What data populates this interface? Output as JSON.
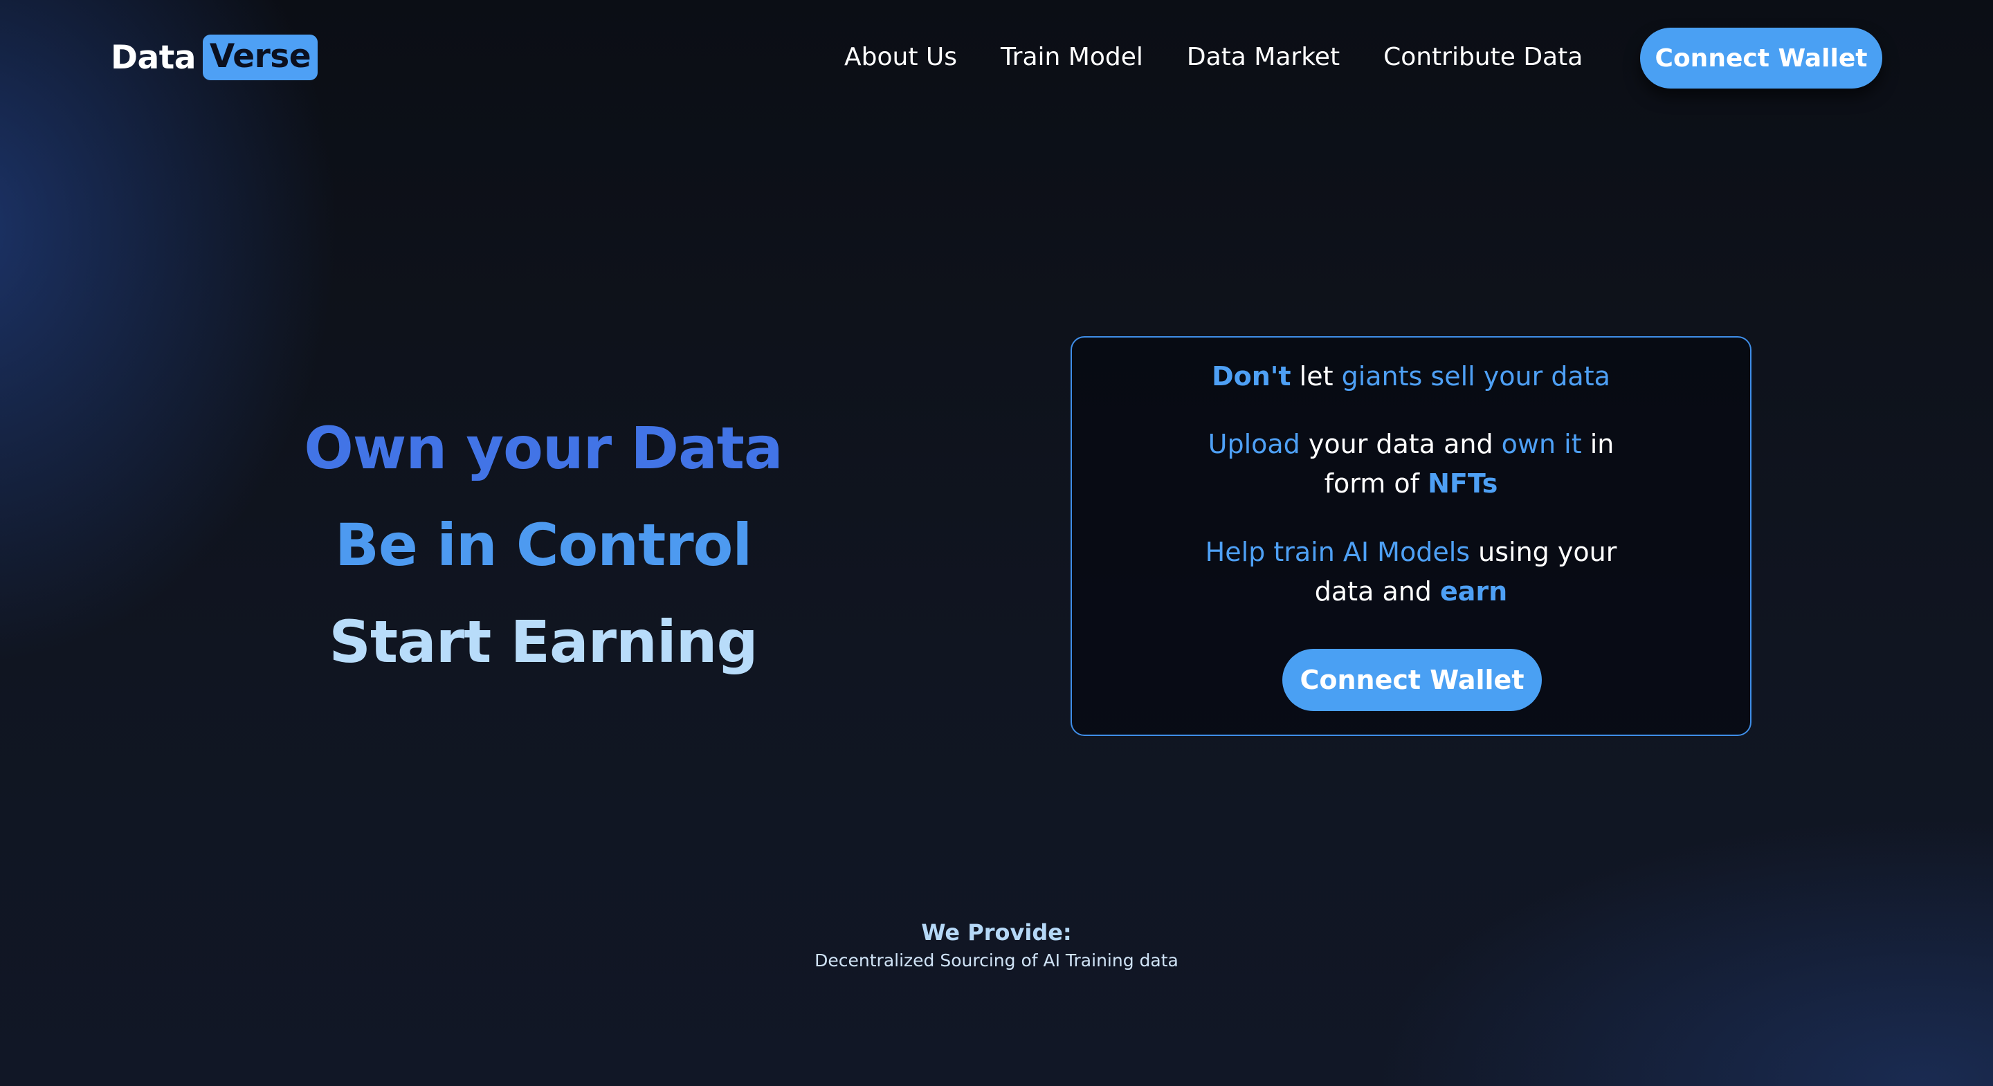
{
  "header": {
    "logo": {
      "part1": "Data",
      "part2": "Verse"
    },
    "nav": [
      "About Us",
      "Train Model",
      "Data Market",
      "Contribute Data"
    ],
    "cta": "Connect Wallet"
  },
  "hero": {
    "lines": [
      "Own your Data",
      "Be in Control",
      "Start Earning"
    ]
  },
  "card": {
    "line1": {
      "a": "Don't",
      "b": " let ",
      "c": "giants sell your data"
    },
    "line2": {
      "a": "Upload",
      "b": " your data and ",
      "c": "own it",
      "d": " in form of ",
      "e": "NFTs"
    },
    "line3": {
      "a": "Help train AI Models",
      "b": " using your data and ",
      "c": "earn"
    },
    "button": "Connect Wallet"
  },
  "provide": {
    "title": "We Provide:",
    "subtitle": "Decentralized Sourcing of AI Training data"
  },
  "colors": {
    "accent": "#4ea0f5",
    "button": "#4aa0f3",
    "hero_line1": "#4274e6",
    "hero_line2": "#4d9af0",
    "hero_line3": "#b8dcfa",
    "background": "#0e121b"
  }
}
